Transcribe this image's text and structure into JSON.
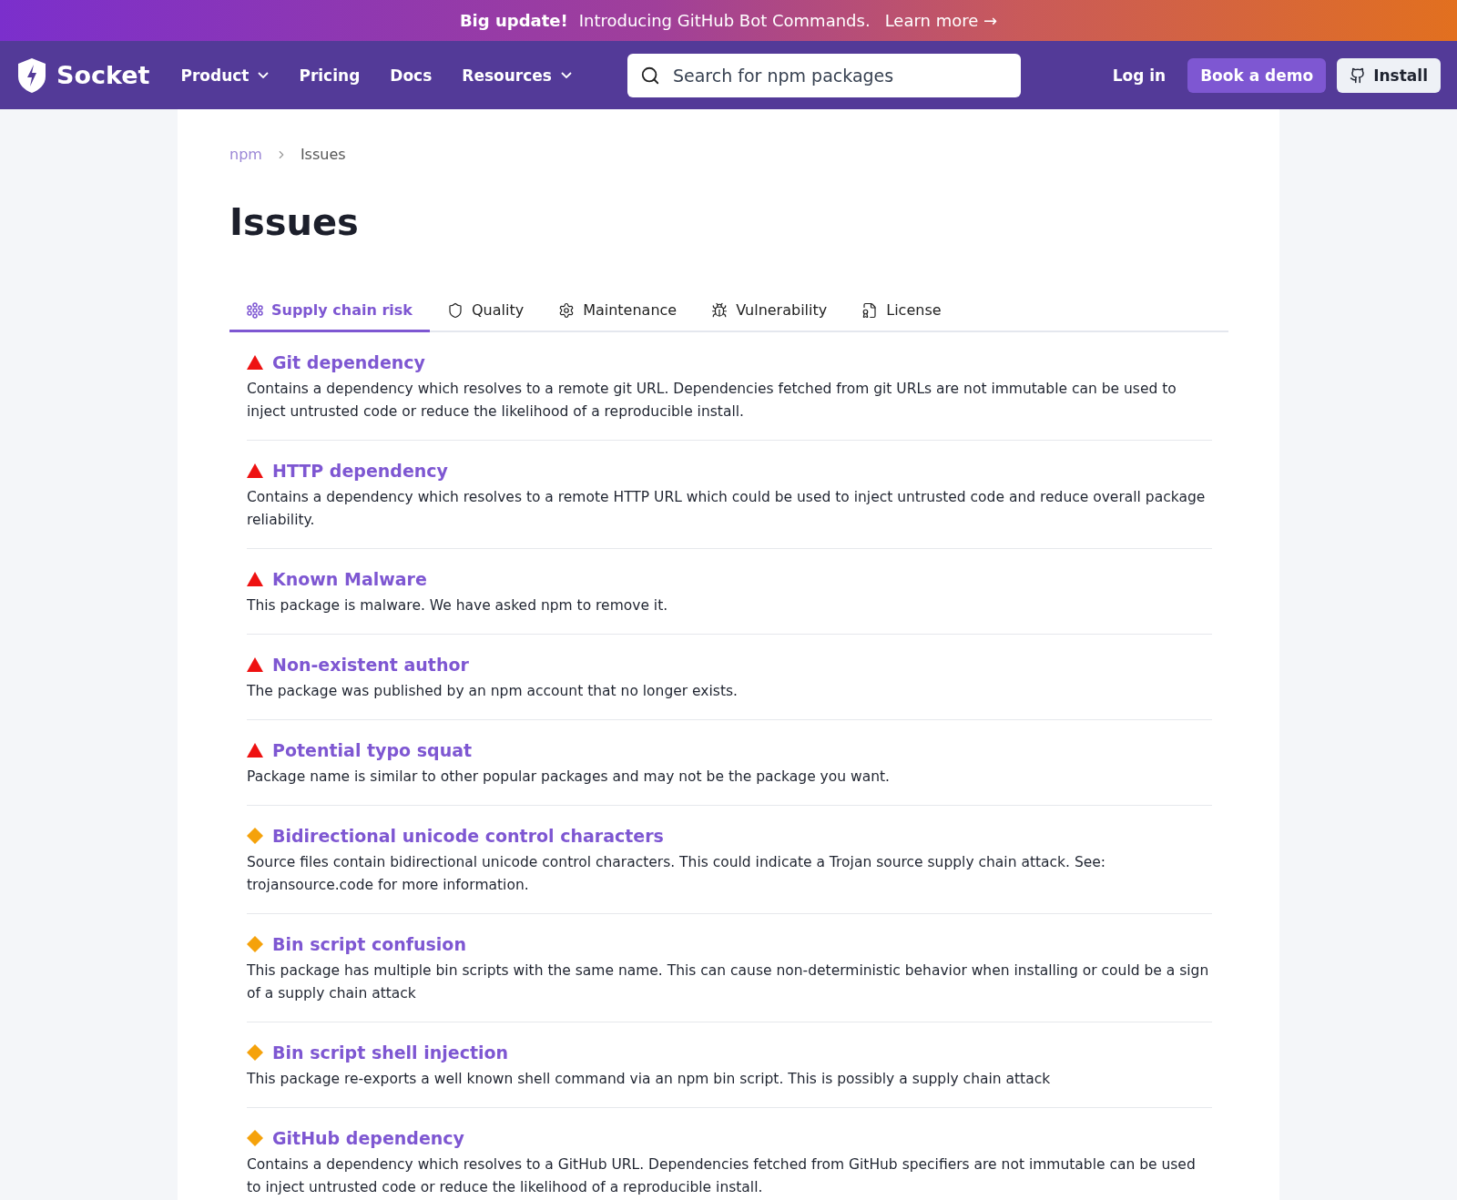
{
  "banner": {
    "headline": "Big update!",
    "text": "Introducing GitHub Bot Commands.",
    "link": "Learn more →"
  },
  "nav": {
    "logo": "Socket",
    "items": [
      {
        "label": "Product",
        "dropdown": true
      },
      {
        "label": "Pricing",
        "dropdown": false
      },
      {
        "label": "Docs",
        "dropdown": false
      },
      {
        "label": "Resources",
        "dropdown": true
      }
    ],
    "search": {
      "placeholder": "Search for npm packages"
    },
    "login": "Log in",
    "demo": "Book a demo",
    "install": "Install"
  },
  "breadcrumb": [
    "npm",
    "Issues"
  ],
  "title": "Issues",
  "tabs": [
    {
      "label": "Supply chain risk",
      "selected": true
    },
    {
      "label": "Quality",
      "selected": false
    },
    {
      "label": "Maintenance",
      "selected": false
    },
    {
      "label": "Vulnerability",
      "selected": false
    },
    {
      "label": "License",
      "selected": false
    }
  ],
  "issues": [
    {
      "kind": "critical",
      "title": "Git dependency",
      "description": "Contains a dependency which resolves to a remote git URL. Dependencies fetched from git URLs are not immutable can be used to inject untrusted code or reduce the likelihood of a reproducible install."
    },
    {
      "kind": "critical",
      "title": "HTTP dependency",
      "description": "Contains a dependency which resolves to a remote HTTP URL which could be used to inject untrusted code and reduce overall package reliability."
    },
    {
      "kind": "critical",
      "title": "Known Malware",
      "description": "This package is malware. We have asked npm to remove it."
    },
    {
      "kind": "critical",
      "title": "Non-existent author",
      "description": "The package was published by an npm account that no longer exists."
    },
    {
      "kind": "critical",
      "title": "Potential typo squat",
      "description": "Package name is similar to other popular packages and may not be the package you want."
    },
    {
      "kind": "medium",
      "title": "Bidirectional unicode control characters",
      "description": "Source files contain bidirectional unicode control characters. This could indicate a Trojan source supply chain attack. See: trojansource.code for more information."
    },
    {
      "kind": "medium",
      "title": "Bin script confusion",
      "description": "This package has multiple bin scripts with the same name. This can cause non-deterministic behavior when installing or could be a sign of a supply chain attack"
    },
    {
      "kind": "medium",
      "title": "Bin script shell injection",
      "description": "This package re-exports a well known shell command via an npm bin script. This is possibly a supply chain attack"
    },
    {
      "kind": "medium",
      "title": "GitHub dependency",
      "description": "Contains a dependency which resolves to a GitHub URL. Dependencies fetched from GitHub specifiers are not immutable can be used to inject untrusted code or reduce the likelihood of a reproducible install."
    }
  ]
}
